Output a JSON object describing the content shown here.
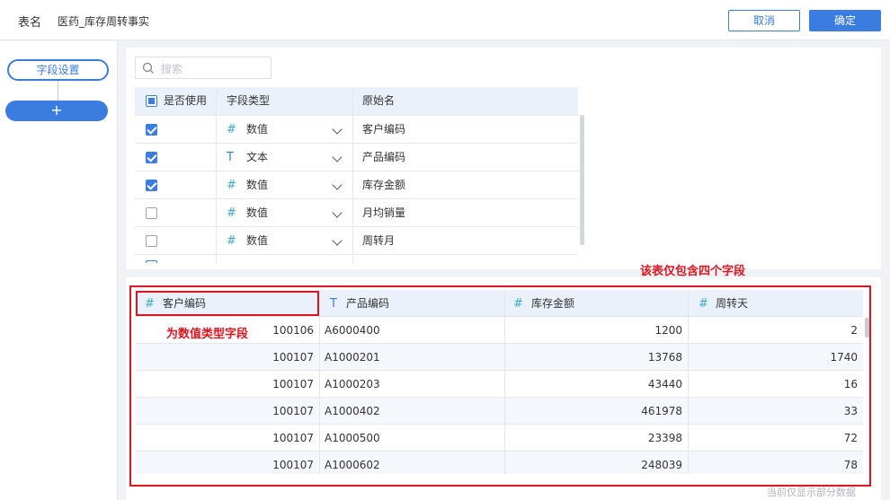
{
  "header": {
    "table_label": "表名",
    "table_name": "医药_库存周转事实",
    "cancel_label": "取消",
    "confirm_label": "确定"
  },
  "sidebar": {
    "step_label": "字段设置",
    "add_label": "+"
  },
  "field_config": {
    "search_placeholder": "搜索",
    "columns": [
      "是否使用",
      "字段类型",
      "原始名"
    ],
    "rows": [
      {
        "checked": true,
        "type_icon": "#",
        "type": "数值",
        "name": "客户编码"
      },
      {
        "checked": true,
        "type_icon": "T",
        "type": "文本",
        "name": "产品编码"
      },
      {
        "checked": true,
        "type_icon": "#",
        "type": "数值",
        "name": "库存金额"
      },
      {
        "checked": false,
        "type_icon": "#",
        "type": "数值",
        "name": "月均销量"
      },
      {
        "checked": false,
        "type_icon": "#",
        "type": "数值",
        "name": "周转月"
      }
    ]
  },
  "preview": {
    "columns": [
      {
        "icon": "#",
        "label": "客户编码"
      },
      {
        "icon": "T",
        "label": "产品编码"
      },
      {
        "icon": "#",
        "label": "库存金额"
      },
      {
        "icon": "#",
        "label": "周转天"
      }
    ],
    "rows": [
      [
        "100106",
        "A6000400",
        "1200",
        "2"
      ],
      [
        "100107",
        "A1000201",
        "13768",
        "1740"
      ],
      [
        "100107",
        "A1000203",
        "43440",
        "16"
      ],
      [
        "100107",
        "A1000402",
        "461978",
        "33"
      ],
      [
        "100107",
        "A1000500",
        "23398",
        "72"
      ],
      [
        "100107",
        "A1000602",
        "248039",
        "78"
      ]
    ],
    "footer_note": "当前仅显示部分数据"
  },
  "annotations": {
    "four_fields": "该表仅包含四个字段",
    "numeric_field": "为数值类型字段"
  },
  "colors": {
    "accent": "#3a7ce0",
    "annotation_red": "#e0141e",
    "numeric_icon": "#3fa9c9"
  }
}
